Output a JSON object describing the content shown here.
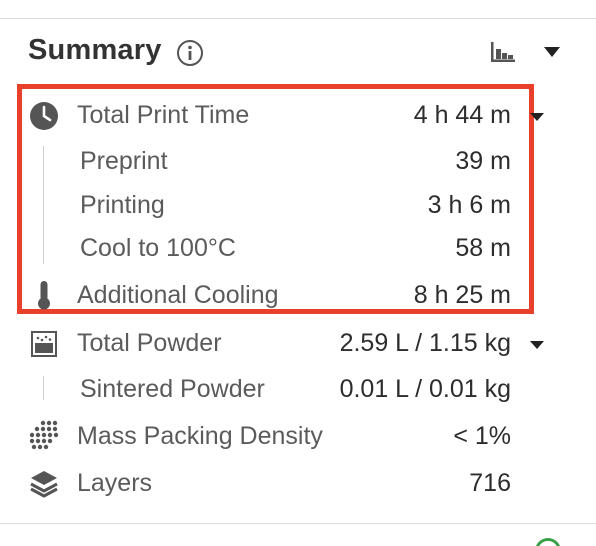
{
  "summary": {
    "title": "Summary"
  },
  "print_time": {
    "total_label": "Total Print Time",
    "total_value": "4 h 44 m",
    "children": [
      {
        "label": "Preprint",
        "value": "39 m"
      },
      {
        "label": "Printing",
        "value": "3 h 6 m"
      },
      {
        "label": "Cool to 100°C",
        "value": "58 m"
      }
    ],
    "additional_label": "Additional Cooling",
    "additional_value": "8 h 25 m"
  },
  "powder": {
    "total_label": "Total Powder",
    "total_value": "2.59 L / 1.15 kg",
    "sintered_label": "Sintered Powder",
    "sintered_value": "0.01 L / 0.01 kg"
  },
  "mass_packing": {
    "label": "Mass Packing Density",
    "value": "< 1%"
  },
  "layers": {
    "label": "Layers",
    "value": "716"
  },
  "colors": {
    "highlight": "#e8402a",
    "label_text": "#5b5b5b",
    "value_text": "#2d2d2d",
    "icon": "#5a5a5a"
  },
  "icons": [
    "info-icon",
    "bar-chart-icon",
    "caret-down-icon",
    "clock-icon",
    "thermometer-icon",
    "powder-icon",
    "density-dots-icon",
    "layers-icon"
  ]
}
